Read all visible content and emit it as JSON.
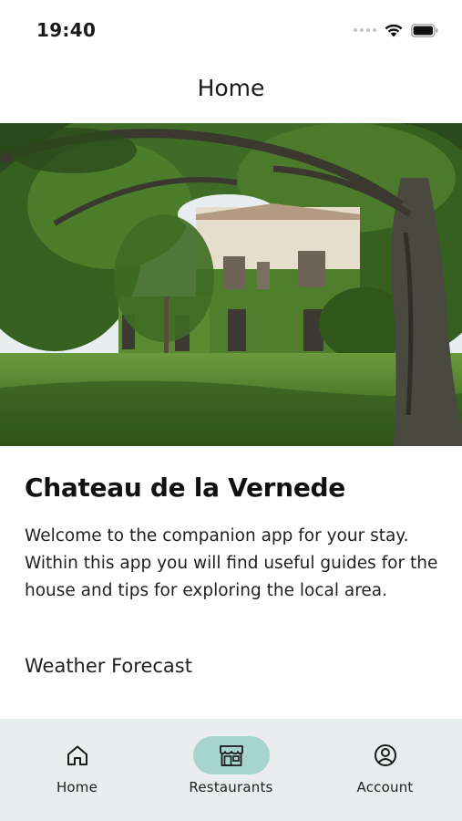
{
  "status_bar": {
    "time": "19:40",
    "icons": [
      "cellular-icon",
      "wifi-icon",
      "battery-icon"
    ]
  },
  "header": {
    "title": "Home"
  },
  "hero_image": {
    "subject": "Chateau with ivy-covered facade beneath a large tree on a green lawn"
  },
  "main": {
    "title": "Chateau de la Vernede",
    "welcome_text": "Welcome to the companion app for your stay. Within this app you will find useful guides for the house and tips for exploring the local area.",
    "section_heading": "Weather Forecast"
  },
  "tab_bar": {
    "active_tab": "Restaurants",
    "active_color": "#a8d4ce",
    "background_color": "#e9edee",
    "tabs": [
      {
        "label": "Home",
        "icon": "home-icon"
      },
      {
        "label": "Restaurants",
        "icon": "storefront-icon"
      },
      {
        "label": "Account",
        "icon": "account-icon"
      }
    ]
  }
}
